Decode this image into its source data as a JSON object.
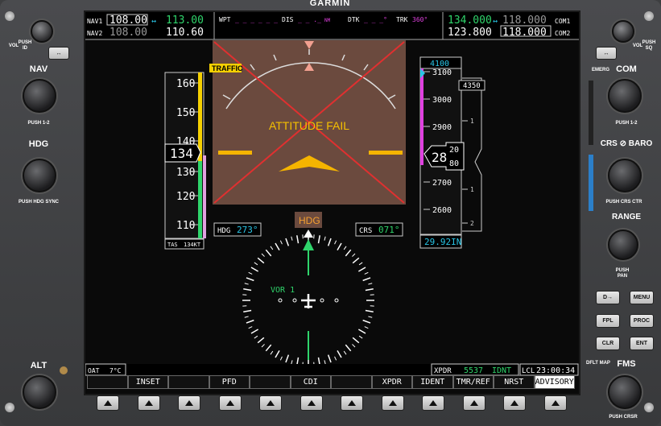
{
  "brand": "GARMIN",
  "left_panel": {
    "vol_label": "VOL",
    "push_id": "PUSH ID",
    "swap_icon": "swap-arrows",
    "nav_label": "NAV",
    "push_12": "PUSH 1-2",
    "hdg_label": "HDG",
    "push_hdg_sync": "PUSH HDG SYNC",
    "alt_label": "ALT"
  },
  "right_panel": {
    "vol_label": "VOL",
    "push_sq": "PUSH SQ",
    "emerg": "EMERG",
    "com_label": "COM",
    "push_12": "PUSH 1-2",
    "crs_baro": "CRS",
    "baro": "BARO",
    "push_crs_ctr": "PUSH CRS CTR",
    "range_label": "RANGE",
    "push_pan": "PUSH PAN",
    "direct_to": "D",
    "menu": "MENU",
    "fpl": "FPL",
    "proc": "PROC",
    "clr": "CLR",
    "ent": "ENT",
    "dflt_map": "DFLT MAP",
    "fms_label": "FMS",
    "push_crsr": "PUSH CRSR"
  },
  "top_bar": {
    "nav1_label": "NAV1",
    "nav1_active": "108.00",
    "nav1_standby": "113.00",
    "nav2_label": "NAV2",
    "nav2_active": "108.00",
    "nav2_standby": "110.60",
    "wpt_label": "WPT",
    "wpt_value": "_ _ _ _ _ _",
    "dis_label": "DIS",
    "dis_value": "_ _ ._",
    "dis_unit": "NM",
    "dtk_label": "DTK",
    "dtk_value": "_ _ _°",
    "trk_label": "TRK",
    "trk_value": "360°",
    "com1_active": "134.000",
    "com1_standby": "118.000",
    "com1_label": "COM1",
    "com2_active": "123.800",
    "com2_standby": "118.000",
    "com2_label": "COM2"
  },
  "pfd": {
    "traffic": "TRAFFIC",
    "attitude_fail": "ATTITUDE FAIL",
    "airspeed_ticks": [
      "160",
      "150",
      "140",
      "130",
      "120",
      "110"
    ],
    "airspeed_current": "134",
    "airspeed_tens": "5",
    "tas_label": "TAS",
    "tas_value": "134KT",
    "alt_selected": "4100",
    "alt_ticks": [
      "3100",
      "3000",
      "2900",
      "2700",
      "2600"
    ],
    "alt_bug": "4350",
    "alt_current": "28",
    "alt_roll_top": "20",
    "alt_roll_mid": "80",
    "baro": "29.92IN",
    "vsi_ticks": [
      "1",
      "1",
      "2"
    ],
    "hdg_label": "HDG",
    "hdg_value": "273°",
    "crs_label": "CRS",
    "crs_value": "071°",
    "hsi_hdg_box": "HDG",
    "vor_label": "VOR 1"
  },
  "bottom_bar": {
    "oat_label": "OAT",
    "oat_value": "7°C",
    "xpdr_label": "XPDR",
    "xpdr_code": "5537",
    "xpdr_mode": "IDNT",
    "lcl_label": "LCL",
    "lcl_time": "23:00:34"
  },
  "softkeys": [
    "",
    "INSET",
    "",
    "PFD",
    "",
    "CDI",
    "",
    "XPDR",
    "IDENT",
    "TMR/REF",
    "NRST",
    "ADVISORY"
  ],
  "colors": {
    "cyan": "#29c5e6",
    "green": "#2fd46b",
    "magenta": "#e040e0",
    "yellow": "#f5d000",
    "sky_fail": "#6b4a3e"
  }
}
